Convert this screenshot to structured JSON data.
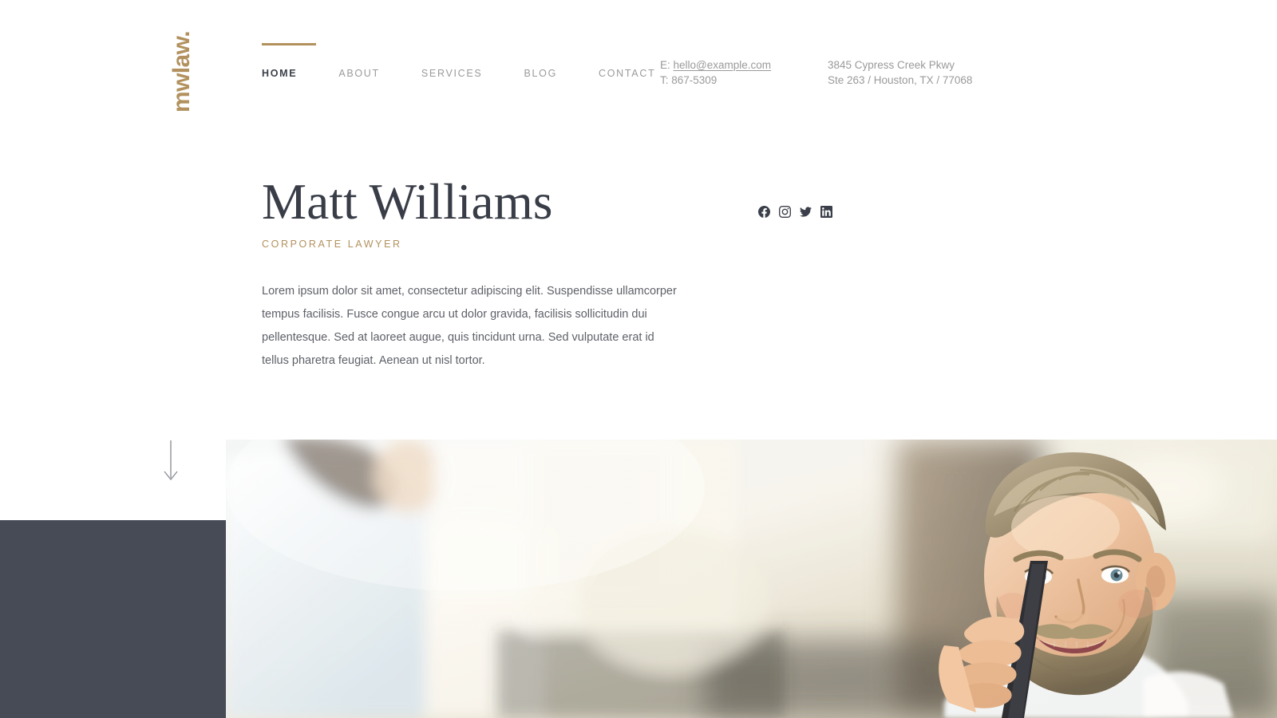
{
  "brand": {
    "logo_text": "mwlaw.",
    "logo_color": "#b2915e"
  },
  "nav": {
    "accent_color": "#b2915e",
    "items": [
      {
        "label": "HOME",
        "active": true
      },
      {
        "label": "ABOUT",
        "active": false
      },
      {
        "label": "SERVICES",
        "active": false
      },
      {
        "label": "BLOG",
        "active": false
      },
      {
        "label": "CONTACT",
        "active": false
      }
    ]
  },
  "contact": {
    "email_prefix": "E:",
    "email": "hello@example.com",
    "phone_line": "T: 867-5309",
    "address_line1": "3845 Cypress Creek Pkwy",
    "address_line2": "Ste 263 / Houston, TX / 77068"
  },
  "hero": {
    "name": "Matt Williams",
    "role": "CORPORATE LAWYER",
    "body": "Lorem ipsum dolor sit amet, consectetur adipiscing elit. Suspendisse ullamcorper tempus facilisis. Fusce congue arcu ut dolor gravida, facilisis sollicitudin dui pellentesque. Sed at laoreet augue, quis tincidunt urna. Sed vulputate erat id tellus pharetra feugiat. Aenean ut nisl tortor.",
    "name_color": "#393d47",
    "role_color": "#b2915e"
  },
  "social": {
    "items": [
      {
        "icon": "facebook-icon",
        "label": "Facebook"
      },
      {
        "icon": "instagram-icon",
        "label": "Instagram"
      },
      {
        "icon": "twitter-icon",
        "label": "Twitter"
      },
      {
        "icon": "linkedin-icon",
        "label": "LinkedIn"
      }
    ]
  },
  "scroll_indicator": {
    "icon": "arrow-down-icon",
    "label": "Scroll down"
  },
  "decor": {
    "dark_block_color": "#474b55"
  },
  "hero_image": {
    "alt": "Smiling bearded businessman talking on a mobile phone outdoors"
  }
}
